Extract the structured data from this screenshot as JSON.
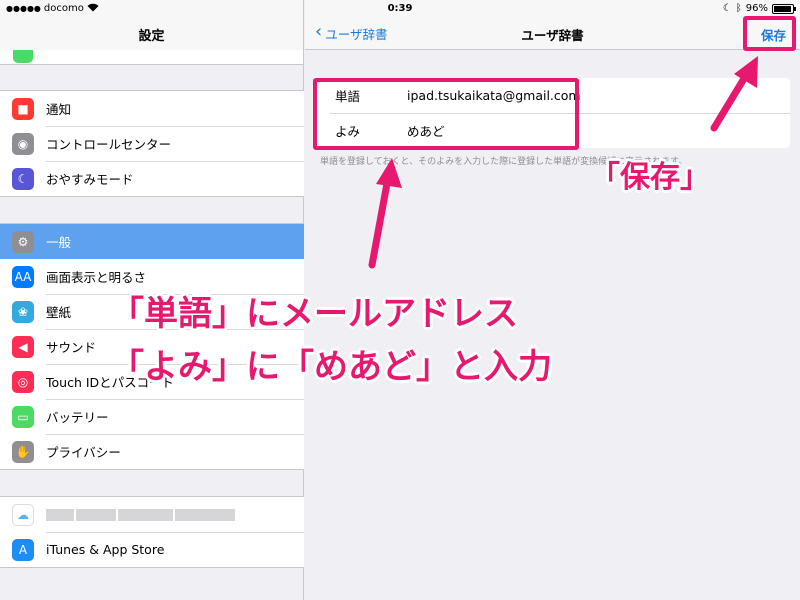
{
  "status_bar": {
    "carrier": "docomo",
    "time": "0:39",
    "battery": "96%",
    "battery_level": 0.96
  },
  "left_pane": {
    "title": "設定",
    "group1": [
      {
        "label": "通知",
        "icon": "bell-icon",
        "color": "#ff3b30",
        "glyph": "■"
      },
      {
        "label": "コントロールセンター",
        "icon": "toggles-icon",
        "color": "#8e8e93",
        "glyph": "◉"
      },
      {
        "label": "おやすみモード",
        "icon": "moon-icon",
        "color": "#5856d6",
        "glyph": "☾"
      }
    ],
    "group2": [
      {
        "label": "一般",
        "icon": "gear-icon",
        "color": "#8e8e93",
        "glyph": "⚙",
        "selected": true
      },
      {
        "label": "画面表示と明るさ",
        "icon": "display-icon",
        "color": "#007aff",
        "glyph": "AA"
      },
      {
        "label": "壁紙",
        "icon": "wallpaper-icon",
        "color": "#34aadc",
        "glyph": "❀"
      },
      {
        "label": "サウンド",
        "icon": "speaker-icon",
        "color": "#ff2d55",
        "glyph": "◀"
      },
      {
        "label": "Touch IDとパスコード",
        "icon": "fingerprint-icon",
        "color": "#ff2d55",
        "glyph": "◎"
      },
      {
        "label": "バッテリー",
        "icon": "battery-icon",
        "color": "#4cd964",
        "glyph": "▭"
      },
      {
        "label": "プライバシー",
        "icon": "hand-icon",
        "color": "#8e8e93",
        "glyph": "✋"
      }
    ],
    "group3": [
      {
        "label": "",
        "icon": "icloud-icon",
        "color": "#ffffff",
        "glyph": "☁",
        "blurred": true
      },
      {
        "label": "iTunes & App Store",
        "icon": "appstore-icon",
        "color": "#1d8cf5",
        "glyph": "A"
      }
    ]
  },
  "right_pane": {
    "back_label": "ユーザ辞書",
    "title": "ユーザ辞書",
    "save_label": "保存",
    "fields": [
      {
        "label": "単語",
        "value": "ipad.tsukaikata@gmail.com"
      },
      {
        "label": "よみ",
        "value": "めあど"
      }
    ],
    "hint": "単語を登録しておくと、そのよみを入力した際に登録した単語が変換候補に表示されます。"
  },
  "annotations": {
    "save_callout": "「保存」",
    "instruction_line1": "「単語」にメールアドレス",
    "instruction_line2": "「よみ」に「めあど」と入力",
    "accent_color": "#e6196e"
  }
}
